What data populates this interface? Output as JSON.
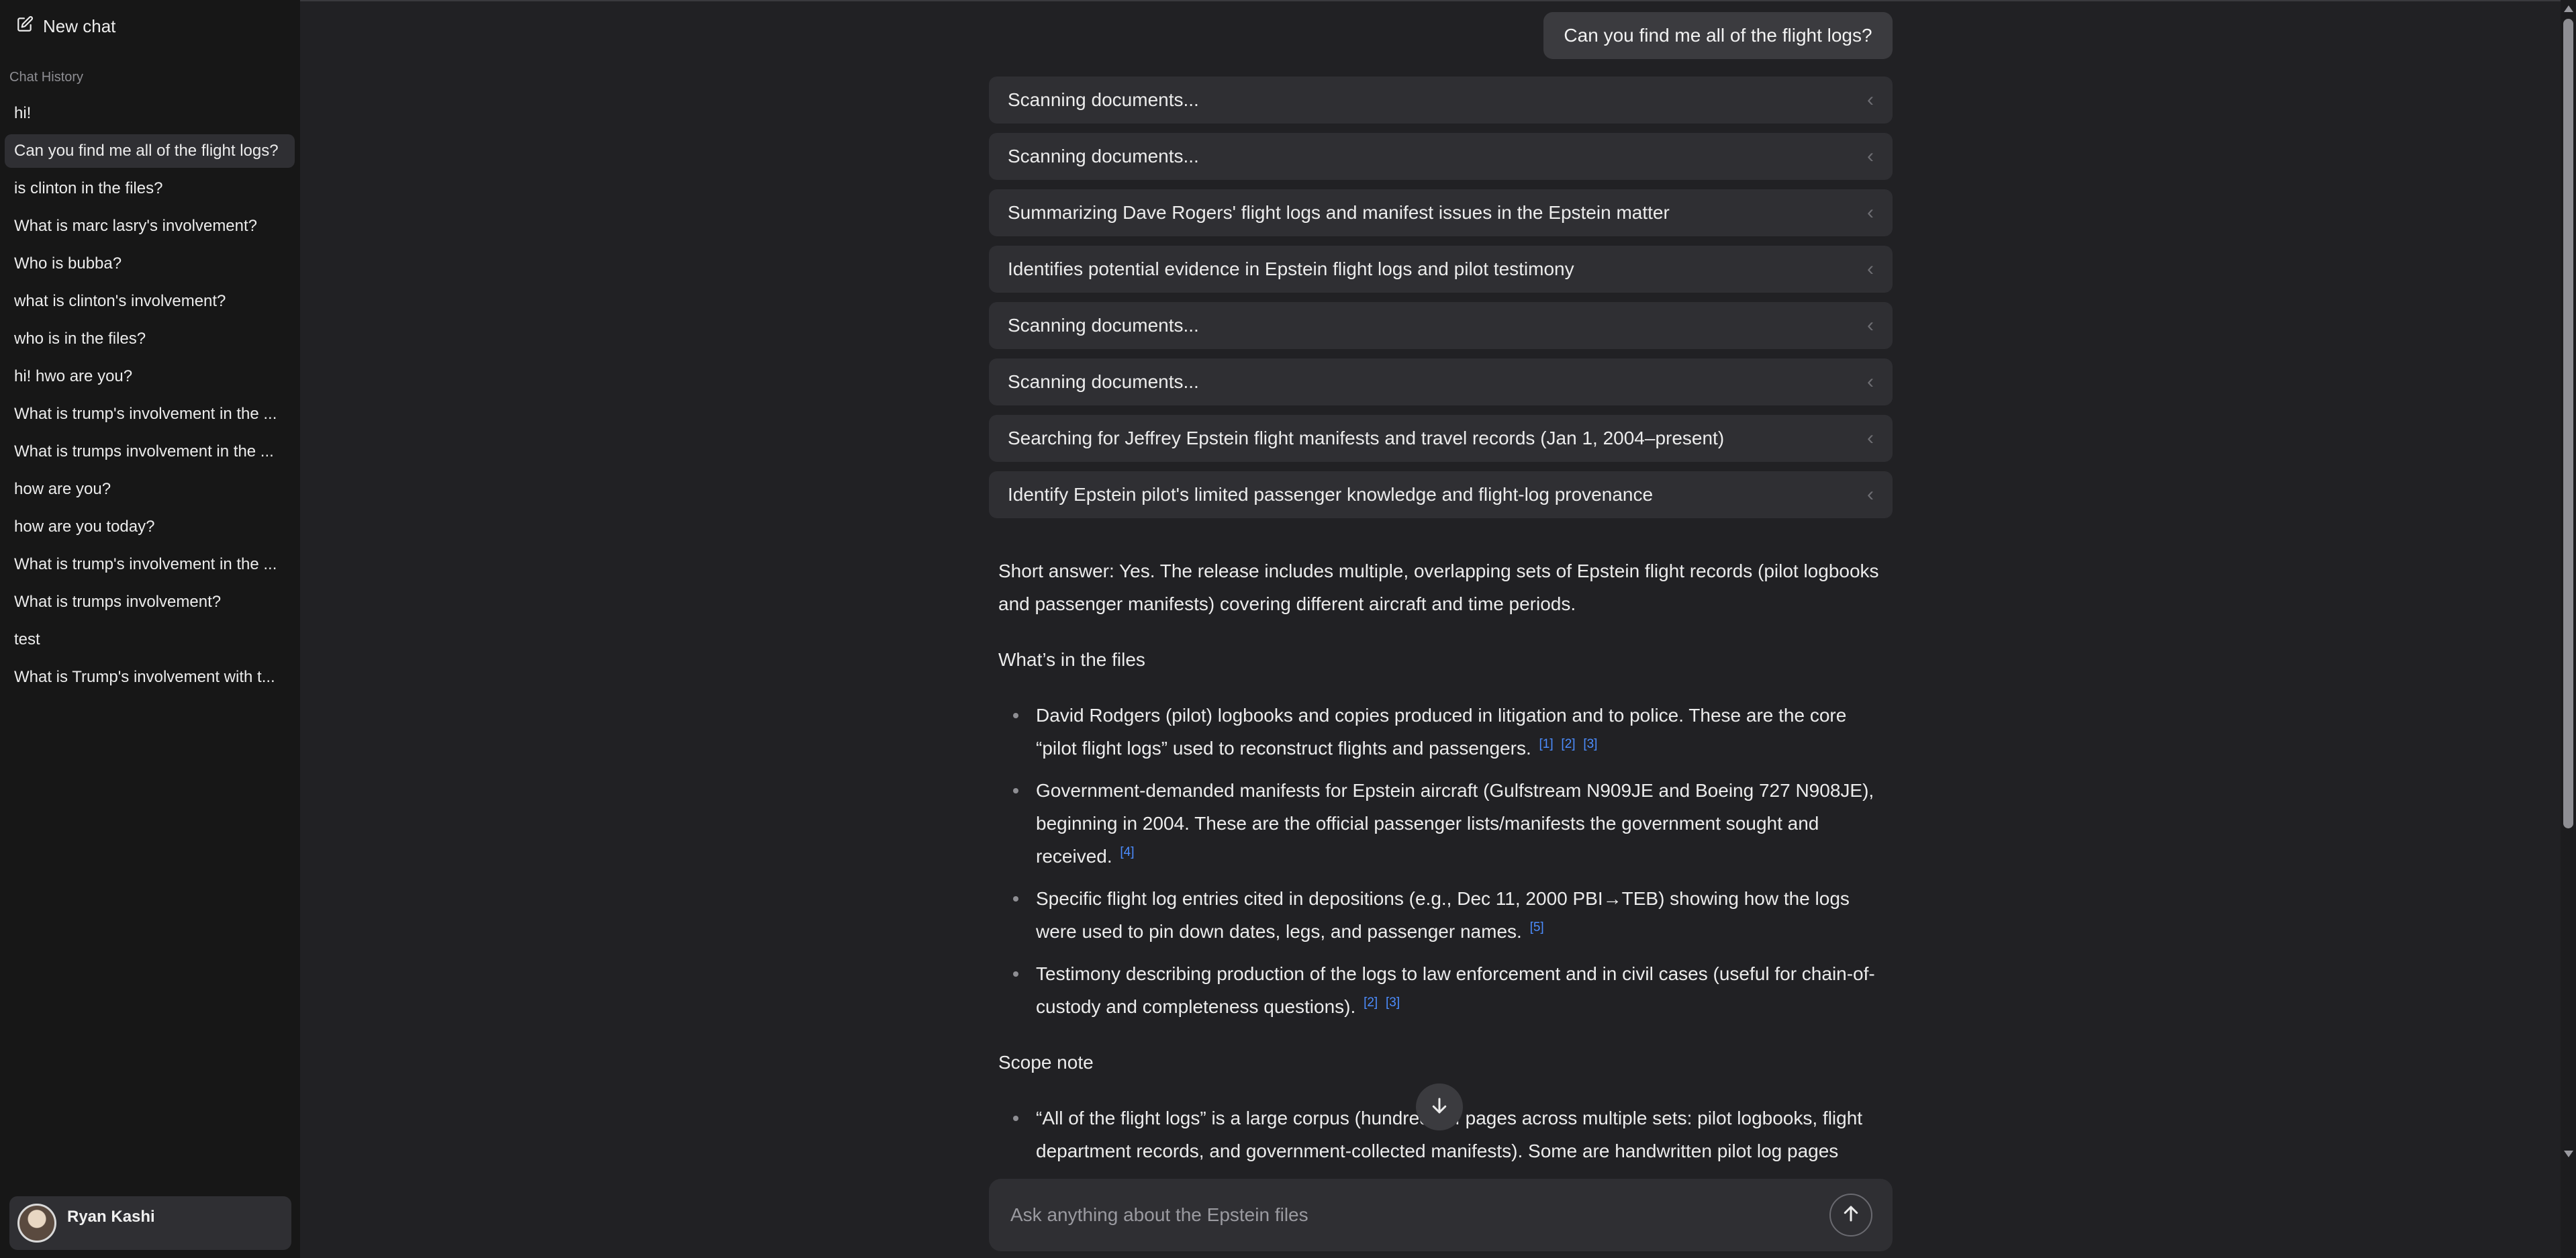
{
  "sidebar": {
    "new_chat_label": "New chat",
    "history_label": "Chat History",
    "items": [
      {
        "label": "hi!"
      },
      {
        "label": "Can you find me all of the flight logs?",
        "active": true
      },
      {
        "label": "is clinton in the files?"
      },
      {
        "label": "What is marc lasry's involvement?"
      },
      {
        "label": "Who is bubba?"
      },
      {
        "label": "what is clinton's involvement?"
      },
      {
        "label": "who is in the files?"
      },
      {
        "label": "hi! hwo are you?"
      },
      {
        "label": "What is trump's involvement in the ..."
      },
      {
        "label": "What is trumps involvement in the ..."
      },
      {
        "label": "how are you?"
      },
      {
        "label": "how are you today?"
      },
      {
        "label": "What is trump's involvement in the ..."
      },
      {
        "label": "What is trumps involvement?"
      },
      {
        "label": "test"
      },
      {
        "label": "What is Trump's involvement with t..."
      }
    ],
    "user": {
      "name": "Ryan Kashi"
    }
  },
  "conversation": {
    "user_message": "Can you find me all of the flight logs?",
    "steps": [
      {
        "label": "Scanning documents..."
      },
      {
        "label": "Scanning documents..."
      },
      {
        "label": "Summarizing Dave Rogers' flight logs and manifest issues in the Epstein matter"
      },
      {
        "label": "Identifies potential evidence in Epstein flight logs and pilot testimony"
      },
      {
        "label": "Scanning documents..."
      },
      {
        "label": "Scanning documents..."
      },
      {
        "label": "Searching for Jeffrey Epstein flight manifests and travel records (Jan 1, 2004–present)"
      },
      {
        "label": "Identify Epstein pilot's limited passenger knowledge and flight-log provenance"
      }
    ],
    "answer": {
      "intro": "Short answer: Yes. The release includes multiple, overlapping sets of Epstein flight records (pilot logbooks and passenger manifests) covering different aircraft and time periods.",
      "section1_title": "What’s in the files",
      "bullets1": [
        {
          "text": "David Rodgers (pilot) logbooks and copies produced in litigation and to police. These are the core “pilot flight logs” used to reconstruct flights and passengers.",
          "cites": [
            "[1]",
            "[2]",
            "[3]"
          ]
        },
        {
          "text": "Government-demanded manifests for Epstein aircraft (Gulfstream N909JE and Boeing 727 N908JE), beginning in 2004. These are the official passenger lists/manifests the government sought and received.",
          "cites": [
            "[4]"
          ]
        },
        {
          "text": "Specific flight log entries cited in depositions (e.g., Dec 11, 2000 PBI→TEB) showing how the logs were used to pin down dates, legs, and passenger names.",
          "cites": [
            "[5]"
          ]
        },
        {
          "text": "Testimony describing production of the logs to law enforcement and in civil cases (useful for chain-of-custody and completeness questions).",
          "cites": [
            "[2]",
            "[3]"
          ]
        }
      ],
      "section2_title": "Scope note",
      "bullets2": [
        {
          "text": "“All of the flight logs” is a large corpus (hundreds of pages across multiple sets: pilot logbooks, flight department records, and government-collected manifests). Some are handwritten pilot log pages",
          "cites": []
        }
      ]
    }
  },
  "composer": {
    "placeholder": "Ask anything about the Epstein files"
  },
  "icons": {
    "new_chat": "edit-icon",
    "step_chevron": "chevron-left-icon",
    "scroll_down": "arrow-down-icon",
    "send": "arrow-up-icon"
  }
}
